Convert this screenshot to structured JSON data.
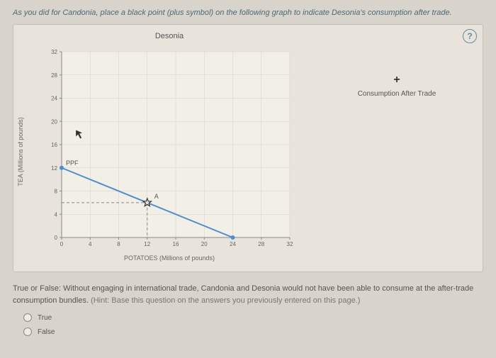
{
  "prompt": "As you did for Candonia, place a black point (plus symbol) on the following graph to indicate Desonia's consumption after trade.",
  "help_label": "?",
  "chart_data": {
    "type": "line",
    "title": "Desonia",
    "xlabel": "POTATOES (Millions of pounds)",
    "ylabel": "TEA (Millions of pounds)",
    "xlim": [
      0,
      32
    ],
    "ylim": [
      0,
      32
    ],
    "xticks": [
      0,
      4,
      8,
      12,
      16,
      20,
      24,
      28,
      32
    ],
    "yticks": [
      0,
      4,
      8,
      12,
      16,
      20,
      24,
      28,
      32
    ],
    "series": [
      {
        "name": "PPF",
        "color": "#4a8fd6",
        "points": [
          [
            0,
            12
          ],
          [
            24,
            0
          ]
        ]
      }
    ],
    "markers": [
      {
        "name": "A",
        "x": 12,
        "y": 6,
        "shape": "star",
        "color": "#333",
        "guides": true
      }
    ],
    "cursor": {
      "x": 2,
      "y": 18.5
    }
  },
  "legend": {
    "marker": "+",
    "label": "Consumption After Trade"
  },
  "question": {
    "text": "True or False: Without engaging in international trade, Candonia and Desonia would not have been able to consume at the after-trade consumption bundles. ",
    "hint": "(Hint: Base this question on the answers you previously entered on this page.)",
    "options": [
      "True",
      "False"
    ]
  }
}
